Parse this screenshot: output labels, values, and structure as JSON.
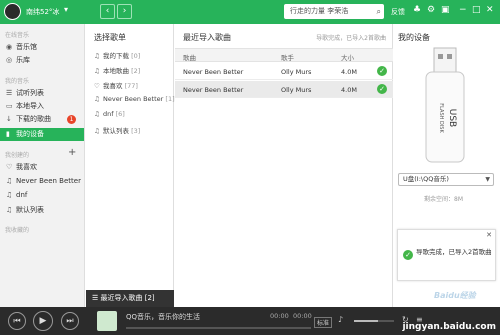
{
  "topbar": {
    "username": "南纬52°冰",
    "search_placeholder": "行走的力量 李荣浩",
    "links": [
      "反馈"
    ],
    "back_icon": "chevron-left-icon",
    "forward_icon": "chevron-right-icon"
  },
  "sidebar": {
    "section_online": "在线音乐",
    "online_items": [
      {
        "label": "音乐馆",
        "icon": "music-hall-icon"
      },
      {
        "label": "乐库",
        "icon": "library-icon"
      }
    ],
    "section_mine": "我的音乐",
    "mine_items": [
      {
        "label": "试听列表",
        "icon": "list-icon"
      },
      {
        "label": "本地导入",
        "icon": "import-icon"
      },
      {
        "label": "下载的歌曲",
        "icon": "download-icon",
        "badge": "1"
      },
      {
        "label": "我的设备",
        "icon": "device-icon",
        "active": true
      }
    ],
    "section_created": "我创建的",
    "created_items": [
      {
        "label": "我喜欢",
        "icon": "heart-icon"
      },
      {
        "label": "Never Been Better",
        "icon": "note-icon"
      },
      {
        "label": "dnf",
        "icon": "note-icon"
      },
      {
        "label": "默认列表",
        "icon": "note-icon"
      }
    ],
    "section_collected": "我收藏的"
  },
  "playlists": {
    "title": "选择歌单",
    "items": [
      {
        "label": "我的下载",
        "count": "[0]"
      },
      {
        "label": "本地歌曲",
        "count": "[2]"
      },
      {
        "label": "我喜欢",
        "count": "[77]"
      },
      {
        "label": "Never Been Better",
        "count": "[1]"
      },
      {
        "label": "dnf",
        "count": "[6]"
      },
      {
        "label": "默认列表",
        "count": "[3]"
      }
    ],
    "recent": "最近导入歌曲",
    "recent_count": "[2]"
  },
  "songs": {
    "title": "最近导入歌曲",
    "status": "导歌完成，已导入2首歌曲",
    "columns": [
      "歌曲",
      "歌手",
      "大小"
    ],
    "rows": [
      {
        "song": "Never Been Better",
        "artist": "Olly Murs",
        "size": "4.0M"
      },
      {
        "song": "Never Been Better",
        "artist": "Olly Murs",
        "size": "4.0M"
      }
    ]
  },
  "device": {
    "title": "我的设备",
    "usb_label_1": "USB",
    "usb_label_2": "FLASH DISK",
    "selected": "U盘(I:\\QQ音乐)",
    "space": "剩余空间：8M",
    "toast": "导歌完成，已导入2首歌曲",
    "watermark": "Baidu经验"
  },
  "player": {
    "track": "QQ音乐，音乐你的生活",
    "elapsed": "00:00",
    "total": "00:00",
    "quality": "标准",
    "progress": 0,
    "volume": 0.6,
    "footer": "jingyan.baidu.com"
  }
}
